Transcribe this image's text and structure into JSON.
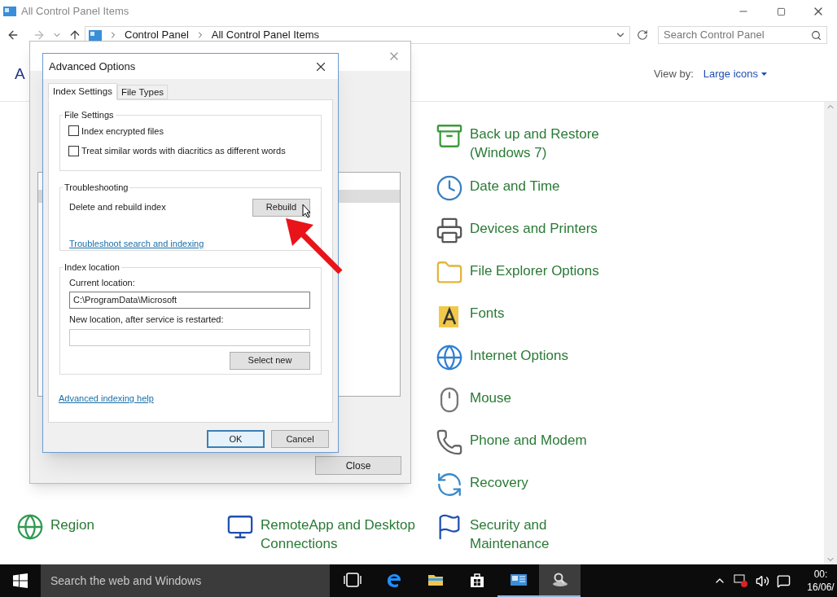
{
  "window": {
    "title": "All Control Panel Items",
    "breadcrumb": [
      "Control Panel",
      "All Control Panel Items"
    ],
    "search": {
      "placeholder": "Search Control Panel"
    },
    "heading": "A",
    "view_by": {
      "label": "View by:",
      "value": "Large icons"
    }
  },
  "rows": [
    {
      "right": {
        "label": "Back up and Restore (Windows 7)",
        "kind": "backup"
      }
    },
    {
      "right": {
        "label": "Date and Time",
        "kind": "clock"
      }
    },
    {
      "right": {
        "label": "Devices and Printers",
        "kind": "printer"
      }
    },
    {
      "right": {
        "label": "File Explorer Options",
        "kind": "folder"
      }
    },
    {
      "right": {
        "label": "Fonts",
        "kind": "fonts"
      }
    },
    {
      "right": {
        "label": "Internet Options",
        "kind": "globe"
      }
    },
    {
      "right": {
        "label": "Mouse",
        "kind": "mouse"
      }
    },
    {
      "right": {
        "label": "Phone and Modem",
        "kind": "phone"
      }
    },
    {
      "right": {
        "label": "Recovery",
        "kind": "recovery"
      }
    },
    {
      "left": {
        "label": "Region",
        "kind": "region"
      },
      "middle": {
        "label": "RemoteApp and Desktop Connections",
        "kind": "remote"
      },
      "right": {
        "label": "Security and Maintenance",
        "kind": "flag"
      }
    }
  ],
  "indexing_dialog": {
    "close_button": "Close"
  },
  "advanced_dialog": {
    "title": "Advanced Options",
    "tabs": [
      {
        "label": "Index Settings",
        "selected": true
      },
      {
        "label": "File Types",
        "selected": false
      }
    ],
    "file_settings": {
      "title": "File Settings",
      "options": [
        {
          "label": "Index encrypted files",
          "checked": false
        },
        {
          "label": "Treat similar words with diacritics as different words",
          "checked": false
        }
      ]
    },
    "troubleshooting": {
      "title": "Troubleshooting",
      "text": "Delete and rebuild index",
      "button": "Rebuild",
      "link": "Troubleshoot search and indexing"
    },
    "index_location": {
      "title": "Index location",
      "current_label": "Current location:",
      "current_value": "C:\\ProgramData\\Microsoft",
      "new_label": "New location, after service is restarted:",
      "button": "Select new"
    },
    "help_link": "Advanced indexing help",
    "buttons": [
      {
        "label": "OK",
        "default": true
      },
      {
        "label": "Cancel",
        "default": false
      }
    ]
  },
  "taskbar": {
    "search": {
      "placeholder": "Search the web and Windows"
    },
    "apps": [
      {
        "kind": "task-view",
        "active": false,
        "selected": false
      },
      {
        "kind": "edge",
        "active": false,
        "selected": false
      },
      {
        "kind": "explorer",
        "active": false,
        "selected": false
      },
      {
        "kind": "store",
        "active": false,
        "selected": false
      },
      {
        "kind": "control-panel",
        "active": true,
        "selected": false
      },
      {
        "kind": "indexing",
        "active": true,
        "selected": true
      }
    ],
    "clock": {
      "time": "00:",
      "date": "16/06/"
    }
  }
}
